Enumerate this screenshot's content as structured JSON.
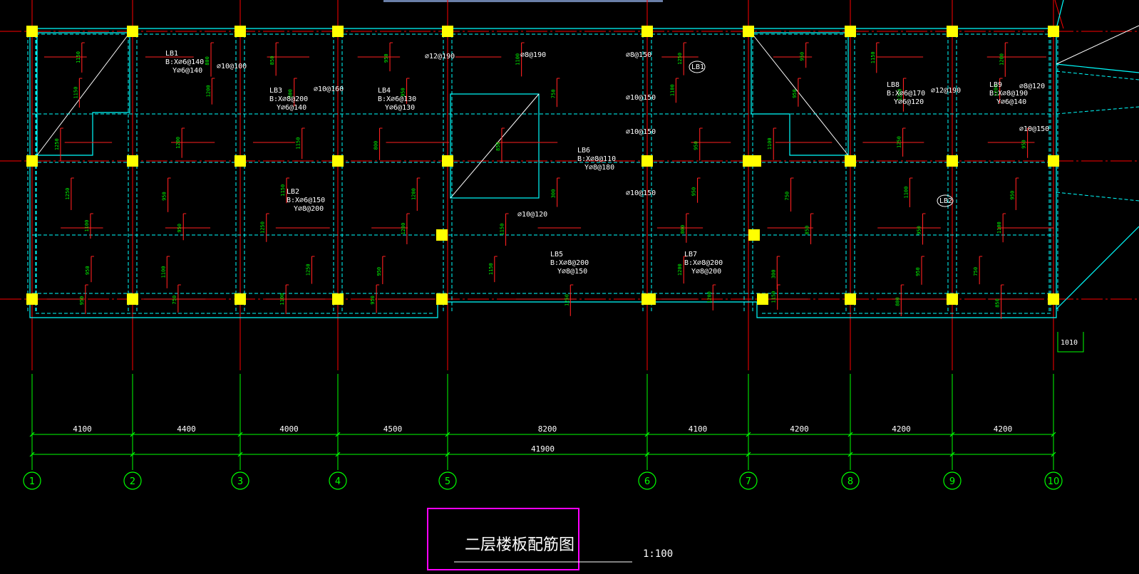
{
  "drawing": {
    "title": "二层楼板配筋图",
    "scale": "1:100",
    "total_length": "41900",
    "colors": {
      "background": "#000000",
      "axis": "#ff0000",
      "dim": "#00ff00",
      "slab": "#00ffff",
      "column": "#ffff00",
      "rebar": "#ff2020",
      "title_frame": "#ff00ff"
    }
  },
  "axes": [
    {
      "label": "1",
      "span": "4100"
    },
    {
      "label": "2",
      "span": "4400"
    },
    {
      "label": "3",
      "span": "4000"
    },
    {
      "label": "4",
      "span": "4500"
    },
    {
      "label": "5",
      "span": "8200"
    },
    {
      "label": "6",
      "span": "4100"
    },
    {
      "label": "7",
      "span": "4200"
    },
    {
      "label": "8",
      "span": "4200"
    },
    {
      "label": "9",
      "span": "4200"
    },
    {
      "label": "10",
      "span": ""
    }
  ],
  "slab_labels": [
    {
      "name": "LB1",
      "bx": "B:X⌀6@140",
      "y": "Y⌀6@140"
    },
    {
      "name": "LB3",
      "bx": "B:X⌀8@200",
      "y": "Y⌀6@140"
    },
    {
      "name": "LB4",
      "bx": "B:X⌀6@130",
      "y": "Y⌀6@130"
    },
    {
      "name": "LB2",
      "bx": "B:X⌀6@150",
      "y": "Y⌀8@200"
    },
    {
      "name": "LB6",
      "bx": "B:X⌀8@110",
      "y": "Y⌀8@180"
    },
    {
      "name": "LB5",
      "bx": "B:X⌀8@200",
      "y": "Y⌀8@150"
    },
    {
      "name": "LB7",
      "bx": "B:X⌀8@200",
      "y": "Y⌀8@200"
    },
    {
      "name": "LB8",
      "bx": "B:X⌀6@170",
      "y": "Y⌀6@120"
    },
    {
      "name": "LB9",
      "bx": "B:X⌀8@190",
      "y": "Y⌀6@140"
    }
  ],
  "callouts": [
    "LB1",
    "LB2"
  ],
  "rebar_notes": [
    "⌀10@100",
    "⌀10@160",
    "⌀12@190",
    "⌀8@190",
    "⌀8@150",
    "⌀10@150",
    "⌀10@150",
    "⌀10@150",
    "⌀10@120",
    "⌀8@120",
    "⌀12@190",
    "⌀10@150"
  ],
  "dims_misc": [
    "1150",
    "1150",
    "1250",
    "1250",
    "1100",
    "950",
    "950",
    "800",
    "1200",
    "1200",
    "950",
    "950",
    "1100",
    "750",
    "850",
    "300"
  ],
  "side_dim": "1010"
}
